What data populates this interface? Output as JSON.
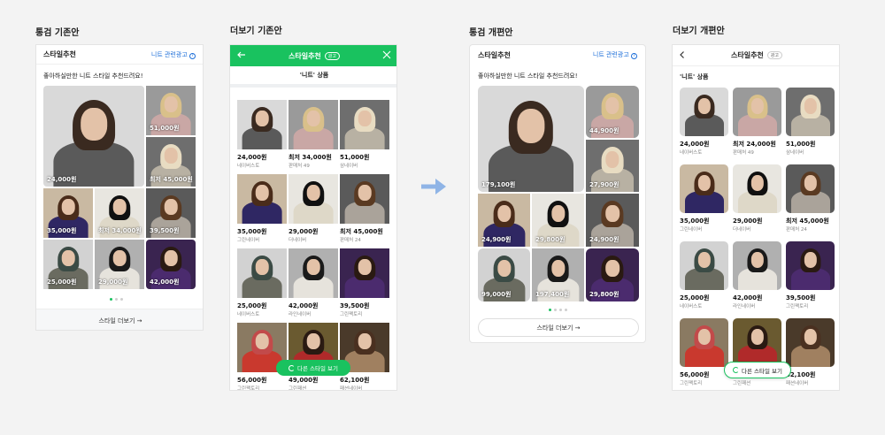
{
  "sections": {
    "s1": "통검 기존안",
    "s2": "더보기 기존안",
    "s3": "통검 개편안",
    "s4": "더보기 개편안"
  },
  "card": {
    "title": "스타일추천",
    "ad_link": "니트 관련광고",
    "subtitle": "좋아하실만한 니트 스타일 추천드려요!",
    "more": "스타일 더보기 →"
  },
  "old_card_prices": [
    "24,000원",
    "51,000원",
    "최저 45,000원",
    "35,000원",
    "최저 34,000원",
    "39,500원",
    "25,000원",
    "29,000원",
    "42,000원"
  ],
  "new_card_prices": [
    "179,100원",
    "44,900원",
    "27,900원",
    "24,900원",
    "29,800원",
    "24,900원",
    "99,000원",
    "197,400원",
    "29,800원"
  ],
  "more_old": {
    "title": "스타일추천",
    "badge": "광고",
    "tab": "'니트' 상품",
    "float_btn": "다른 스타일 보기"
  },
  "more_new": {
    "title": "스타일추천",
    "badge": "광고",
    "tab": "'니트' 상품",
    "float_btn": "다른 스타일 보기"
  },
  "products": [
    {
      "price": "24,000원",
      "shop": "네이버스토"
    },
    {
      "price": "최저 34,000원",
      "shop": "판매처 49"
    },
    {
      "price": "51,000원",
      "shop": "삼네이버"
    },
    {
      "price": "35,000원",
      "shop": "그린네이버"
    },
    {
      "price": "29,000원",
      "shop": "더네이버"
    },
    {
      "price": "최저 45,000원",
      "shop": "판매처 24"
    },
    {
      "price": "25,000원",
      "shop": "네이버스토"
    },
    {
      "price": "42,000원",
      "shop": "라인네이버"
    },
    {
      "price": "39,500원",
      "shop": "그린팩토리"
    },
    {
      "price": "56,000원",
      "shop": "그린팩토리"
    },
    {
      "price": "49,000원",
      "shop": "그린패션"
    },
    {
      "price": "62,100원",
      "shop": "패션네이버"
    }
  ],
  "products_new": [
    {
      "price": "24,000원",
      "shop": "네이버스토"
    },
    {
      "price": "최저 24,000원",
      "shop": "판매처 49"
    },
    {
      "price": "51,000원",
      "shop": "삼네이버"
    },
    {
      "price": "35,000원",
      "shop": "그린네이버"
    },
    {
      "price": "29,000원",
      "shop": "더네이버"
    },
    {
      "price": "최저 45,000원",
      "shop": "판매처 24"
    },
    {
      "price": "25,000원",
      "shop": "네이버스토"
    },
    {
      "price": "42,000원",
      "shop": "라인네이버"
    },
    {
      "price": "39,500원",
      "shop": "그린팩토리"
    },
    {
      "price": "56,000원",
      "shop": "그린팩토리"
    },
    {
      "price": "49,000원",
      "shop": "그린패션"
    },
    {
      "price": "62,100원",
      "shop": "패션네이버"
    }
  ],
  "icons": {
    "help": "help-circle-icon",
    "back": "back-arrow-icon",
    "close": "close-icon",
    "refresh": "refresh-icon",
    "transition": "transition-arrow-icon"
  },
  "colors": {
    "brand_green": "#19c25f",
    "link_blue": "#1e6fd9"
  }
}
